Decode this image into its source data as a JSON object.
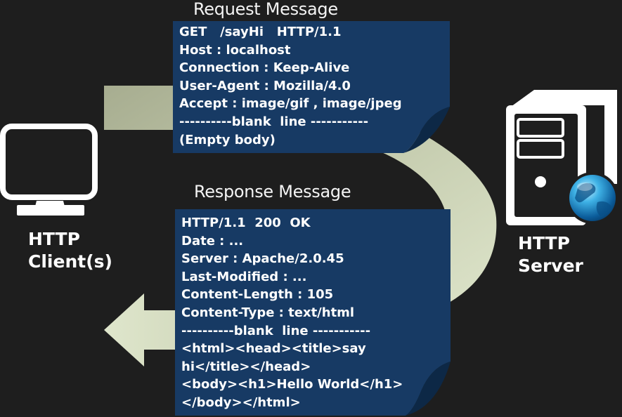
{
  "request": {
    "title": "Request Message",
    "lines": [
      "GET   /sayHi   HTTP/1.1",
      "Host : localhost",
      "Connection : Keep-Alive",
      "User-Agent : Mozilla/4.0",
      "Accept : image/gif , image/jpeg",
      "----------blank  line -----------",
      "(Empty body)"
    ]
  },
  "response": {
    "title": "Response Message",
    "lines": [
      "HTTP/1.1  200  OK",
      "Date : ...",
      "Server : Apache/2.0.45",
      "Last-Modified : ...",
      "Content-Length : 105",
      "Content-Type : text/html",
      "----------blank  line -----------",
      "<html><head><title>say",
      "hi</title></head>",
      "<body><h1>Hello World</h1>",
      "</body></html>"
    ]
  },
  "client": {
    "label_line1": "HTTP",
    "label_line2": "Client(s)",
    "icon": "monitor-icon"
  },
  "server": {
    "label_line1": "HTTP",
    "label_line2": "Server",
    "icon": "server-tower-icon",
    "badge_icon": "globe-icon"
  },
  "colors": {
    "background": "#1e1e1e",
    "card": "#173a64",
    "arrow": "#c9d4b4",
    "text": "#ffffff"
  }
}
